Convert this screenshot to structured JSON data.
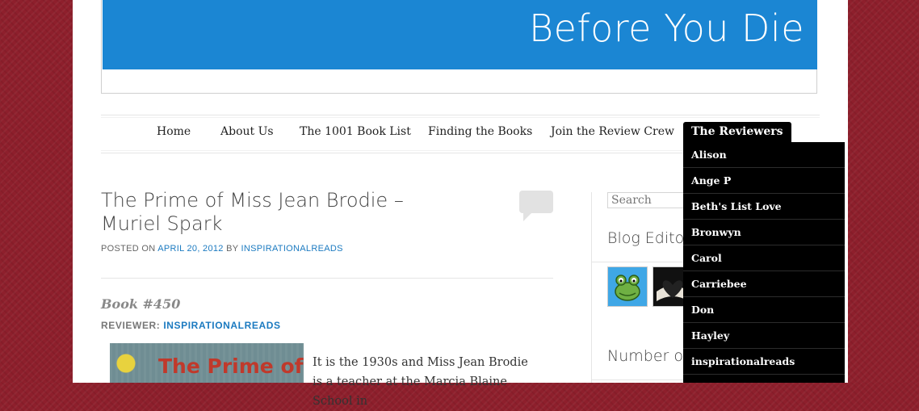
{
  "header": {
    "title": "Before You Die"
  },
  "nav": {
    "items": [
      {
        "label": "Home"
      },
      {
        "label": "About Us"
      },
      {
        "label": "The 1001 Book List"
      },
      {
        "label": "Finding the Books"
      },
      {
        "label": "Join the Review Crew"
      },
      {
        "label": "The Reviewers"
      }
    ],
    "active": "The Reviewers"
  },
  "dropdown": {
    "items": [
      "Alison",
      "Ange P",
      "Beth's List Love",
      "Bronwyn",
      "Carol",
      "Carriebee",
      "Don",
      "Hayley",
      "inspirationalreads"
    ]
  },
  "post": {
    "title": "The Prime of Miss Jean Brodie – Muriel Spark",
    "meta_prefix": "POSTED ON",
    "date": "APRIL 20, 2012",
    "meta_by": "BY",
    "author": "INSPIRATIONALREADS",
    "book_number": "Book #450",
    "reviewer_label": "REVIEWER:",
    "reviewer_name": "INSPIRATIONALREADS",
    "cover_text": "The Prime of",
    "body": "It is the 1930s and Miss Jean Brodie is a teacher at the Marcia Blaine School in"
  },
  "sidebar": {
    "search_placeholder": "Search",
    "blog_editors_title": "Blog Editors",
    "number_title": "Number o"
  },
  "colors": {
    "banner": "#1b86d3",
    "link": "#1b7ac0",
    "background": "#8e1f2c"
  }
}
